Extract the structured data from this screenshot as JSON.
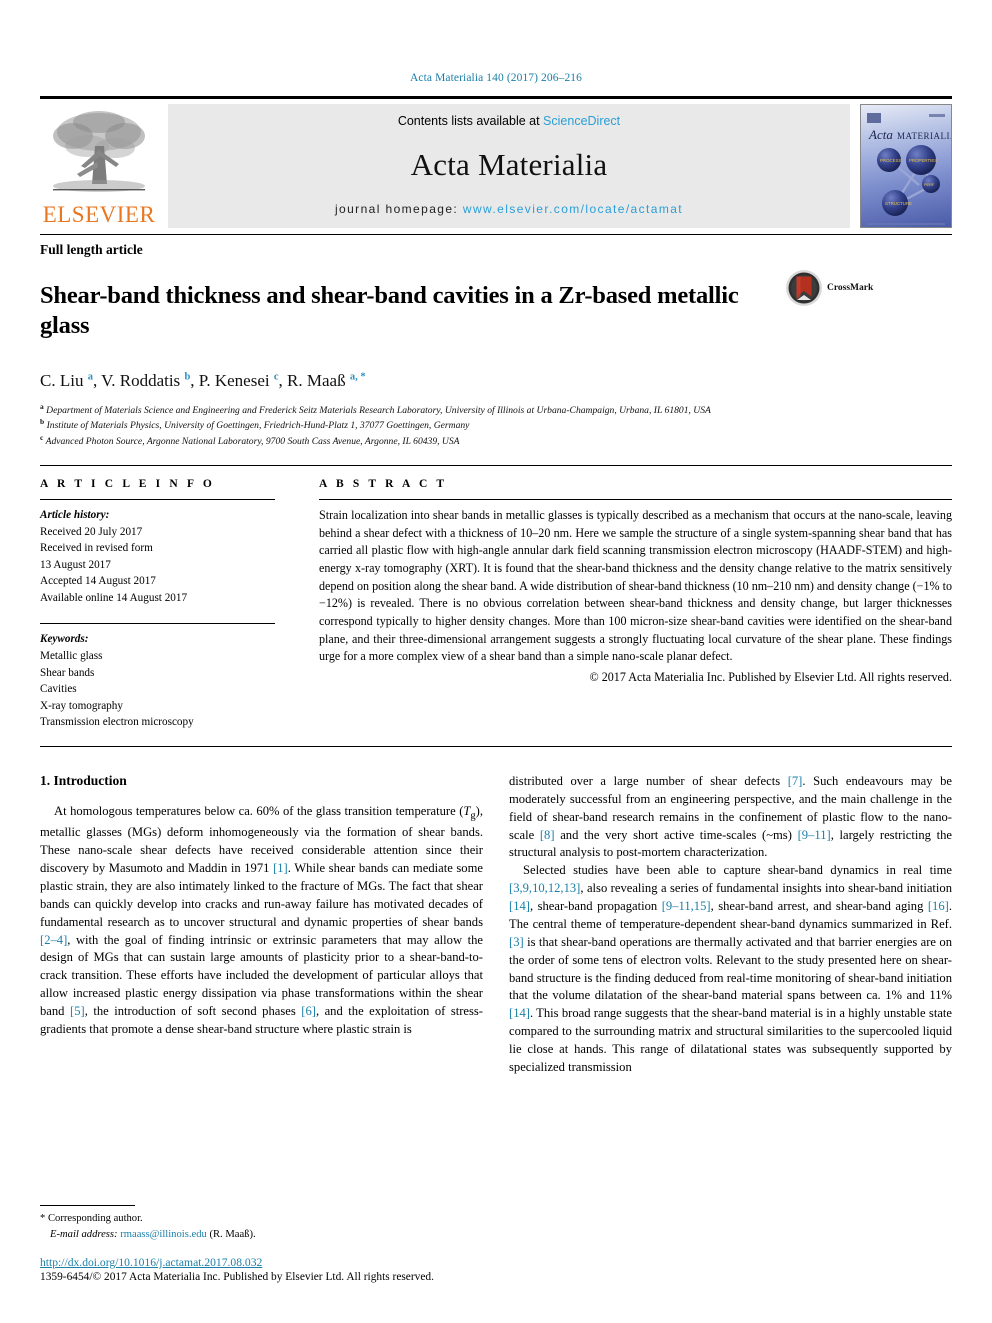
{
  "running_head": "Acta Materialia 140 (2017) 206–216",
  "masthead": {
    "publisher_name": "ELSEVIER",
    "contents_prefix": "Contents lists available at ",
    "contents_link": "ScienceDirect",
    "journal_name": "Acta Materialia",
    "homepage_prefix": "journal homepage: ",
    "homepage_url": "www.elsevier.com/locate/actamat",
    "cover_title_italic": "Acta",
    "cover_title_rest": "MATERIALIA"
  },
  "article": {
    "type": "Full length article",
    "title": "Shear-band thickness and shear-band cavities in a Zr-based metallic glass",
    "crossmark_label": "CrossMark",
    "authors_html": "C. Liu <sup>a</sup>, V. Roddatis <sup>b</sup>, P. Kenesei <sup>c</sup>, R. Maaß <sup>a, *</sup>",
    "affiliations": [
      {
        "marker": "a",
        "text": "Department of Materials Science and Engineering and Frederick Seitz Materials Research Laboratory, University of Illinois at Urbana-Champaign, Urbana, IL 61801, USA"
      },
      {
        "marker": "b",
        "text": "Institute of Materials Physics, University of Goettingen, Friedrich-Hund-Platz 1, 37077 Goettingen, Germany"
      },
      {
        "marker": "c",
        "text": "Advanced Photon Source, Argonne National Laboratory, 9700 South Cass Avenue, Argonne, IL 60439, USA"
      }
    ]
  },
  "article_info": {
    "heading": "A R T I C L E   I N F O",
    "history_label": "Article history:",
    "history": [
      "Received 20 July 2017",
      "Received in revised form",
      "13 August 2017",
      "Accepted 14 August 2017",
      "Available online 14 August 2017"
    ],
    "keywords_label": "Keywords:",
    "keywords": [
      "Metallic glass",
      "Shear bands",
      "Cavities",
      "X-ray tomography",
      "Transmission electron microscopy"
    ]
  },
  "abstract": {
    "heading": "A B S T R A C T",
    "text": "Strain localization into shear bands in metallic glasses is typically described as a mechanism that occurs at the nano-scale, leaving behind a shear defect with a thickness of 10–20 nm. Here we sample the structure of a single system-spanning shear band that has carried all plastic flow with high-angle annular dark field scanning transmission electron microscopy (HAADF-STEM) and high-energy x-ray tomography (XRT). It is found that the shear-band thickness and the density change relative to the matrix sensitively depend on position along the shear band. A wide distribution of shear-band thickness (10 nm–210 nm) and density change (−1% to −12%) is revealed. There is no obvious correlation between shear-band thickness and density change, but larger thicknesses correspond typically to higher density changes. More than 100 micron-size shear-band cavities were identified on the shear-band plane, and their three-dimensional arrangement suggests a strongly fluctuating local curvature of the shear plane. These findings urge for a more complex view of a shear band than a simple nano-scale planar defect.",
    "copyright": "© 2017 Acta Materialia Inc. Published by Elsevier Ltd. All rights reserved."
  },
  "body": {
    "section_title": "1. Introduction",
    "left_paragraphs": [
      "At homologous temperatures below ca. 60% of the glass transition temperature (<i>T</i><sub>g</sub>), metallic glasses (MGs) deform inhomogeneously via the formation of shear bands. These nano-scale shear defects have received considerable attention since their discovery by Masumoto and Maddin in 1971 <span class=\"ref\">[1]</span>. While shear bands can mediate some plastic strain, they are also intimately linked to the fracture of MGs. The fact that shear bands can quickly develop into cracks and run-away failure has motivated decades of fundamental research as to uncover structural and dynamic properties of shear bands <span class=\"ref\">[2–4]</span>, with the goal of finding intrinsic or extrinsic parameters that may allow the design of MGs that can sustain large amounts of plasticity prior to a shear-band-to-crack transition. These efforts have included the development of particular alloys that allow increased plastic energy dissipation via phase transformations within the shear band <span class=\"ref\">[5]</span>, the introduction of soft second phases <span class=\"ref\">[6]</span>, and the exploitation of stress-gradients that promote a dense shear-band structure where plastic strain is"
    ],
    "right_paragraphs": [
      "distributed over a large number of shear defects <span class=\"ref\">[7]</span>. Such endeavours may be moderately successful from an engineering perspective, and the main challenge in the field of shear-band research remains in the confinement of plastic flow to the nano-scale <span class=\"ref\">[8]</span> and the very short active time-scales (~ms) <span class=\"ref\">[9–11]</span>, largely restricting the structural analysis to post-mortem characterization.",
      "Selected studies have been able to capture shear-band dynamics in real time <span class=\"ref\">[3,9,10,12,13]</span>, also revealing a series of fundamental insights into shear-band initiation <span class=\"ref\">[14]</span>, shear-band propagation <span class=\"ref\">[9–11,15]</span>, shear-band arrest, and shear-band aging <span class=\"ref\">[16]</span>. The central theme of temperature-dependent shear-band dynamics summarized in Ref. <span class=\"ref\">[3]</span> is that shear-band operations are thermally activated and that barrier energies are on the order of some tens of electron volts. Relevant to the study presented here on shear-band structure is the finding deduced from real-time monitoring of shear-band initiation that the volume dilatation of the shear-band material spans between ca. 1% and 11% <span class=\"ref\">[14]</span>. This broad range suggests that the shear-band material is in a highly unstable state compared to the surrounding matrix and structural similarities to the supercooled liquid lie close at hands. This range of dilatational states was subsequently supported by specialized transmission"
    ]
  },
  "footer": {
    "corresponding_marker": "*",
    "corresponding_text": "Corresponding author.",
    "email_label": "E-mail address:",
    "email": "rmaass@illinois.edu",
    "email_suffix": "(R. Maaß).",
    "doi": "http://dx.doi.org/10.1016/j.actamat.2017.08.032",
    "issn_line": "1359-6454/© 2017 Acta Materialia Inc. Published by Elsevier Ltd. All rights reserved."
  },
  "colors": {
    "link_blue": "#1b7fa8",
    "sciencedirect_blue": "#2a9fd6",
    "elsevier_orange": "#e87722",
    "band_grey": "#e9e9e9"
  }
}
